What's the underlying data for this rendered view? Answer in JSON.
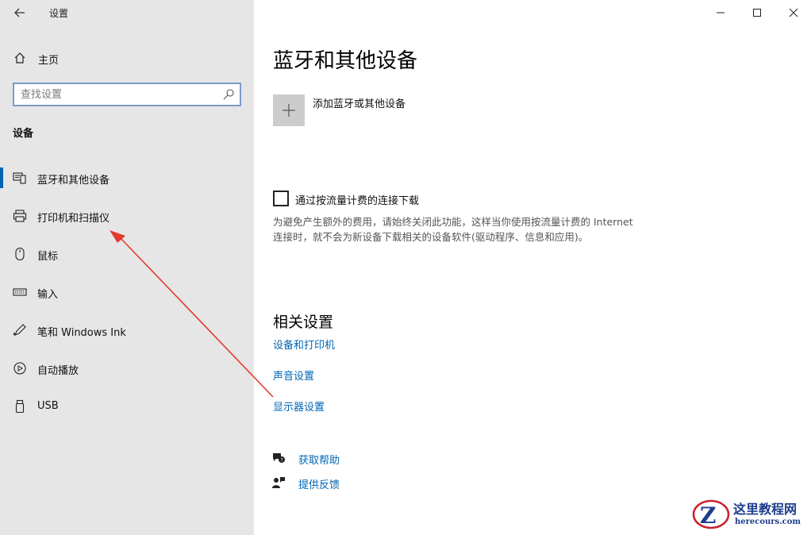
{
  "window": {
    "title": "设置",
    "controls": [
      "minimize-icon",
      "maximize-icon",
      "close-icon"
    ]
  },
  "sidebar": {
    "home_label": "主页",
    "search": {
      "placeholder": "查找设置",
      "value": ""
    },
    "section_title": "设备",
    "items": [
      {
        "label": "蓝牙和其他设备",
        "icon": "bluetooth-devices-icon",
        "active": true
      },
      {
        "label": "打印机和扫描仪",
        "icon": "printer-icon",
        "active": false
      },
      {
        "label": "鼠标",
        "icon": "mouse-icon",
        "active": false
      },
      {
        "label": "输入",
        "icon": "keyboard-icon",
        "active": false
      },
      {
        "label": "笔和 Windows Ink",
        "icon": "pen-icon",
        "active": false
      },
      {
        "label": "自动播放",
        "icon": "autoplay-icon",
        "active": false
      },
      {
        "label": "USB",
        "icon": "usb-icon",
        "active": false
      }
    ]
  },
  "main": {
    "title": "蓝牙和其他设备",
    "add_device_label": "添加蓝牙或其他设备",
    "metered": {
      "label": "通过按流量计费的连接下载",
      "checked": false,
      "description": "为避免产生额外的费用，请始终关闭此功能，这样当你使用按流量计费的 Internet 连接时，就不会为新设备下载相关的设备软件(驱动程序、信息和应用)。"
    },
    "related": {
      "title": "相关设置",
      "links": [
        "设备和打印机",
        "声音设置",
        "显示器设置"
      ]
    },
    "help": {
      "get_help": "获取帮助",
      "feedback": "提供反馈"
    }
  },
  "watermark": {
    "text_cn": "这里教程网",
    "text_url": "herecours.com"
  },
  "colors": {
    "accent": "#0063b1",
    "link": "#0066b4",
    "sidebar_bg": "#e6e6e6",
    "annotation_arrow": "#e23a2e"
  }
}
